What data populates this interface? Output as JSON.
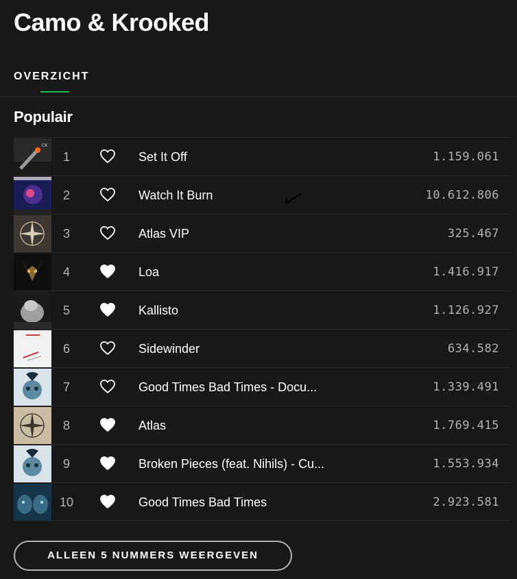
{
  "artist": {
    "name": "Camo & Krooked"
  },
  "tabs": [
    {
      "label": "OVERZICHT",
      "active": true
    }
  ],
  "popular": {
    "title": "Populair",
    "tracks": [
      {
        "number": "1",
        "title": "Set It Off",
        "plays": "1.159.061",
        "liked": false,
        "cover_icon": "cover-set-it-off"
      },
      {
        "number": "2",
        "title": "Watch It Burn",
        "plays": "10.612.806",
        "liked": false,
        "cover_icon": "cover-cross-the-line"
      },
      {
        "number": "3",
        "title": "Atlas VIP",
        "plays": "325.467",
        "liked": false,
        "cover_icon": "cover-compass-dark"
      },
      {
        "number": "4",
        "title": "Loa",
        "plays": "1.416.917",
        "liked": true,
        "cover_icon": "cover-loa-mask"
      },
      {
        "number": "5",
        "title": "Kallisto",
        "plays": "1.126.927",
        "liked": true,
        "cover_icon": "cover-kallisto-head"
      },
      {
        "number": "6",
        "title": "Sidewinder",
        "plays": "634.582",
        "liked": false,
        "cover_icon": "cover-sidewinder"
      },
      {
        "number": "7",
        "title": "Good Times Bad Times - Docu...",
        "plays": "1.339.491",
        "liked": false,
        "cover_icon": "cover-mosaik"
      },
      {
        "number": "8",
        "title": "Atlas",
        "plays": "1.769.415",
        "liked": true,
        "cover_icon": "cover-compass-light"
      },
      {
        "number": "9",
        "title": "Broken Pieces (feat. Nihils) - Cu...",
        "plays": "1.553.934",
        "liked": true,
        "cover_icon": "cover-mosaik"
      },
      {
        "number": "10",
        "title": "Good Times Bad Times",
        "plays": "2.923.581",
        "liked": true,
        "cover_icon": "cover-faces"
      }
    ]
  },
  "show_less_button": {
    "label": "ALLEEN 5 NUMMERS WEERGEVEN"
  },
  "colors": {
    "background": "#181818",
    "accent": "#1db954",
    "text": "#ffffff",
    "muted": "#b3b3b3",
    "divider": "#282828"
  }
}
